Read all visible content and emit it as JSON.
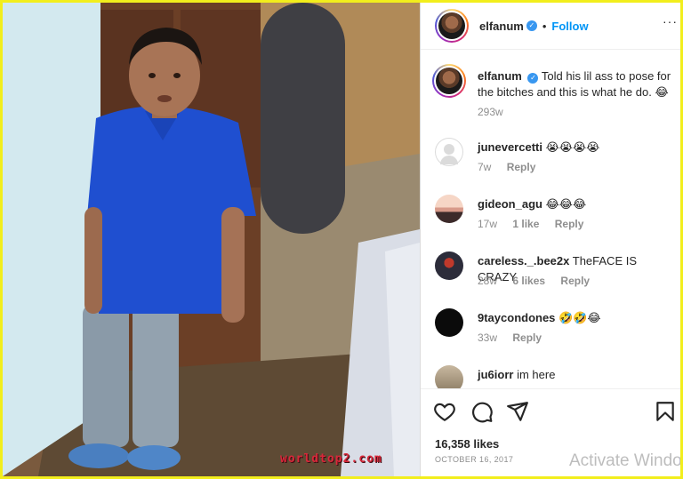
{
  "post": {
    "username": "elfanum",
    "verified": true,
    "follow_label": "Follow",
    "separator": "•",
    "more_icon": "more-options-icon"
  },
  "caption": {
    "username": "elfanum",
    "text": "Told his lil ass to pose for the bitches and this is what he do. 😂",
    "time": "293w"
  },
  "comments": [
    {
      "username": "junevercetti",
      "text": "😭😭😭😭",
      "time": "7w",
      "likes": "",
      "reply": "Reply"
    },
    {
      "username": "gideon_agu",
      "text": "😂😂😂",
      "time": "17w",
      "likes": "1 like",
      "reply": "Reply"
    },
    {
      "username": "careless._.bee2x",
      "text": "TheFACE IS CRAZY",
      "time": "28w",
      "likes": "6 likes",
      "reply": "Reply"
    },
    {
      "username": "9taycondones",
      "text": "🤣🤣😂",
      "time": "33w",
      "likes": "",
      "reply": "Reply"
    },
    {
      "username": "ju6iorr",
      "text": "im here",
      "time": "",
      "likes": "",
      "reply": ""
    }
  ],
  "actions": {
    "icons": [
      "heart-icon",
      "comment-icon",
      "share-icon",
      "bookmark-icon"
    ],
    "likes": "16,358 likes",
    "date": "OCTOBER 16, 2017"
  },
  "overlay": {
    "watermark": "worldtop2.com",
    "activate_windows": "Activate Windo"
  },
  "colors": {
    "border_highlight": "#f2ee1c",
    "link_blue": "#0095f6",
    "verified_blue": "#3897f0",
    "muted_text": "#8e8e8e",
    "watermark_red": "#d8283a"
  }
}
